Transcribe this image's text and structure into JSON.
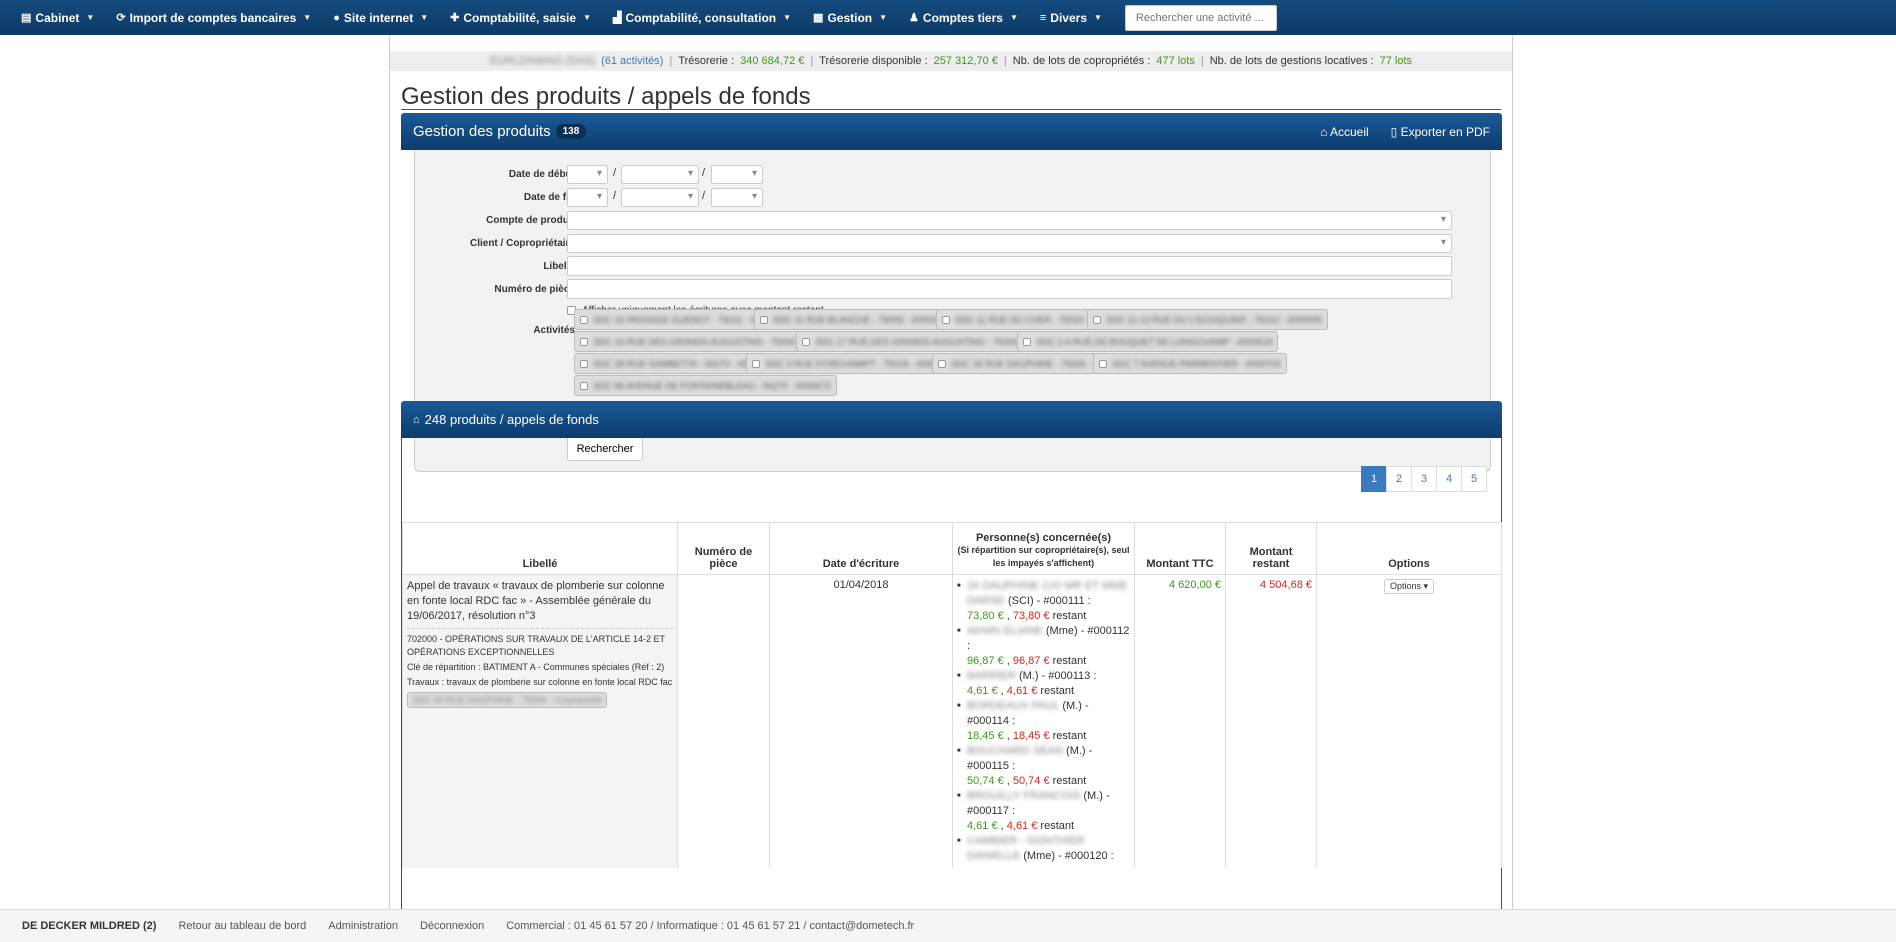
{
  "navbar": {
    "items": [
      {
        "icon": "file-icon",
        "glyph": "▤",
        "label": "Cabinet"
      },
      {
        "icon": "refresh-icon",
        "glyph": "⟳",
        "label": "Import de comptes bancaires"
      },
      {
        "icon": "globe-icon",
        "glyph": "●",
        "label": "Site internet"
      },
      {
        "icon": "plus-icon",
        "glyph": "✚",
        "label": "Comptabilité, saisie"
      },
      {
        "icon": "chart-icon",
        "glyph": "▟",
        "label": "Comptabilité, consultation"
      },
      {
        "icon": "calendar-icon",
        "glyph": "▦",
        "label": "Gestion"
      },
      {
        "icon": "users-icon",
        "glyph": "♟",
        "label": "Comptes tiers"
      },
      {
        "icon": "menu-icon",
        "glyph": "≡",
        "label": "Divers"
      }
    ],
    "search_placeholder": "Rechercher une activité ..."
  },
  "stats": {
    "company": "EURLDINMAD (SAS)",
    "activities": "(61 activités)",
    "tresorerie_label": "Trésorerie :",
    "tresorerie_value": "340 684,72 €",
    "dispo_label": "Trésorerie disponible :",
    "dispo_value": "257 312,70 €",
    "copro_label": "Nb. de lots de copropriétés :",
    "copro_value": "477 lots",
    "locatives_label": "Nb. de lots de gestions locatives :",
    "locatives_value": "77 lots"
  },
  "page_title": "Gestion des produits / appels de fonds",
  "panel": {
    "title": "Gestion des produits",
    "count": "138",
    "home_label": "Accueil",
    "export_label": "Exporter en PDF"
  },
  "filters": {
    "date_debut": "Date de début",
    "date_fin": "Date de fin",
    "compte_produit": "Compte de produit",
    "client": "Client / Copropriétaire",
    "libelle": "Libellé",
    "numero_piece": "Numéro de pièce",
    "only_remaining": "Afficher uniquement les écritures avec montant restant",
    "activites": "Activités",
    "search_button": "Rechercher",
    "activities_list": [
      "SDC 10 PASSAGE GUENOT - 75011 - #000003",
      "SDC 11 RUE BLANCHE - 75009 - #000346",
      "SDC 11 RUE DU CHER - 75020 - #000004",
      "SDC 11-13 RUE DU L'ECHIQUIER - 75010 - #000005",
      "SDC 15 RUE DES GRANDS AUGUSTINS - 75006 - #000410",
      "SDC 17 RUE DES GRANDS AUGUSTINS - 75006 - #000302",
      "SDC 2-4 RUE DE BOUQUET DE LONGCHAMP - #000618",
      "SDC 28 RUE GAMBETTA - 94270 - #000006",
      "SDC 3 RUE D'ORCHAMPT - 75018 - #000007",
      "SDC 34 RUE DAUPHINE - 75006 - #000008",
      "SDC 7 AVENUE PARMENTIER - #000704",
      "SDC 86 AVENUE DE FONTAINEBLEAU - 94270 - #000672"
    ]
  },
  "results": {
    "title": "248 produits / appels de fonds",
    "pages": [
      "1",
      "2",
      "3",
      "4",
      "5"
    ],
    "columns": {
      "libelle": "Libellé",
      "numero": "Numéro de pièce",
      "date": "Date d'écriture",
      "personnes": "Personne(s) concernée(s)",
      "personnes_sub": "(Si répartition sur copropriétaire(s), seul les impayés s'affichent)",
      "montant": "Montant TTC",
      "restant": "Montant restant",
      "options": "Options"
    },
    "row": {
      "libelle": "Appel de travaux « travaux de plomberie sur colonne en fonte local RDC fac » - Assemblée générale du 19/06/2017, résolution n°3",
      "compte": "702000 - OPÉRATIONS SUR TRAVAUX DE L'ARTICLE 14-2 ET OPÉRATIONS EXCEPTIONNELLES",
      "cle": "Clé de répartition : BATIMENT A - Communes spéciales (Réf : 2)",
      "travaux": "Travaux : travaux de plomberie sur colonne en fonte local RDC fac",
      "activite_tag": "SDC 34 RUE DAUPHINE - 75006 - Copropriété",
      "date": "01/04/2018",
      "montant": "4 620,00 €",
      "restant": "4 504,68 €",
      "options_label": "Options",
      "persons": [
        {
          "name": "34 DAUPHINE C/O MR ET MME DARSE",
          "suffix": " (SCI) - #000111 :",
          "amount": "73,80 €",
          "rest": "73,80 €"
        },
        {
          "name": "AKNIN ELIANE",
          "suffix": " (Mme) - #000112 :",
          "amount": "96,87 €",
          "rest": "96,87 €"
        },
        {
          "name": "BARRIER",
          "suffix": " (M.) - #000113 :",
          "amount": "4,61 €",
          "rest": "4,61 €"
        },
        {
          "name": "BORDEAUX PAUL",
          "suffix": " (M.) - #000114 :",
          "amount": "18,45 €",
          "rest": "18,45 €"
        },
        {
          "name": "BOUCHARD SEAN",
          "suffix": " (M.) - #000115 :",
          "amount": "50,74 €",
          "rest": "50,74 €"
        },
        {
          "name": "BROUILLY FRANCOIS",
          "suffix": " (M.) - #000117 :",
          "amount": "4,61 €",
          "rest": "4,61 €"
        },
        {
          "name": "CAMBIER - GONTHIER DANIELLE",
          "suffix": " (Mme) - #000120 :",
          "amount": "",
          "rest": ""
        }
      ],
      "restant_word": "restant"
    }
  },
  "footer": {
    "user": "DE DECKER MILDRED (2)",
    "dashboard": "Retour au tableau de bord",
    "admin": "Administration",
    "logout": "Déconnexion",
    "contact": "Commercial : 01 45 61 57 20 / Informatique : 01 45 61 57 21 / contact@dometech.fr"
  }
}
